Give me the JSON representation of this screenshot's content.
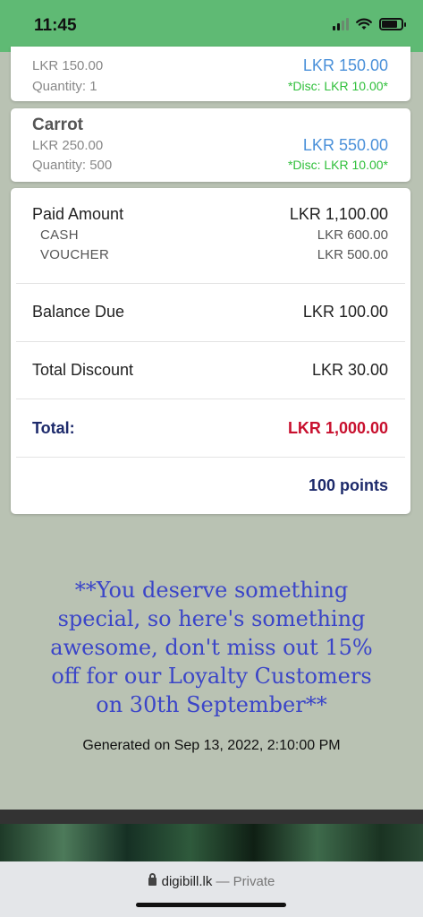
{
  "status_bar": {
    "time": "11:45"
  },
  "items": [
    {
      "unit_price": "LKR 150.00",
      "quantity": "Quantity: 1",
      "total": "LKR 150.00",
      "discount": "*Disc: LKR 10.00*"
    },
    {
      "name": "Carrot",
      "unit_price": "LKR 250.00",
      "quantity": "Quantity: 500",
      "total": "LKR 550.00",
      "discount": "*Disc: LKR 10.00*"
    }
  ],
  "summary": {
    "paid_label": "Paid Amount",
    "paid_value": "LKR 1,100.00",
    "payments": [
      {
        "method": "CASH",
        "amount": "LKR 600.00"
      },
      {
        "method": "VOUCHER",
        "amount": "LKR 500.00"
      }
    ],
    "balance_label": "Balance Due",
    "balance_value": "LKR 100.00",
    "discount_label": "Total Discount",
    "discount_value": "LKR 30.00",
    "total_label": "Total:",
    "total_value": "LKR 1,000.00",
    "points": "100 points"
  },
  "promo": {
    "line1": "**You deserve something",
    "line2": "special, so here's something",
    "line3": "awesome, don't miss out 15%",
    "line4": "off for our Loyalty Customers",
    "line5": "on 30th September**"
  },
  "generated": "Generated on Sep 13, 2022, 2:10:00 PM",
  "browser": {
    "domain": "digibill.lk",
    "mode": "— Private"
  },
  "colors": {
    "accent_green": "#5fba74",
    "price_blue": "#4a90d9",
    "discount_green": "#2fbf3a",
    "total_red": "#c8102e",
    "navy": "#1d2a6b",
    "promo_blue": "#3b45c8"
  }
}
